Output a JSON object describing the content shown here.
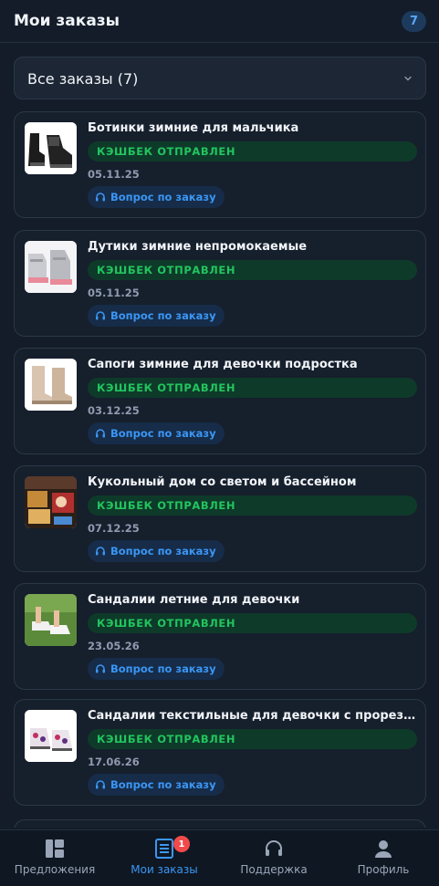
{
  "header": {
    "title": "Мои заказы",
    "count": "7"
  },
  "filter": {
    "label": "Все заказы (7)"
  },
  "orders": [
    {
      "name": "Ботинки зимние для мальчика",
      "status": "КЭШБЕК ОТПРАВЛЕН",
      "date": "05.11.25",
      "ask": "Вопрос по заказу"
    },
    {
      "name": "Дутики зимние непромокаемые",
      "status": "КЭШБЕК ОТПРАВЛЕН",
      "date": "05.11.25",
      "ask": "Вопрос по заказу"
    },
    {
      "name": "Сапоги зимние для девочки подростка",
      "status": "КЭШБЕК ОТПРАВЛЕН",
      "date": "03.12.25",
      "ask": "Вопрос по заказу"
    },
    {
      "name": "Кукольный дом со светом и бассейном",
      "status": "КЭШБЕК ОТПРАВЛЕН",
      "date": "07.12.25",
      "ask": "Вопрос по заказу"
    },
    {
      "name": "Сандалии летние для девочки",
      "status": "КЭШБЕК ОТПРАВЛЕН",
      "date": "23.05.26",
      "ask": "Вопрос по заказу"
    },
    {
      "name": "Сандалии текстильные для девочки с прорезиненн...",
      "status": "КЭШБЕК ОТПРАВЛЕН",
      "date": "17.06.26",
      "ask": "Вопрос по заказу"
    }
  ],
  "nav": {
    "offers": "Предложения",
    "orders": "Мои заказы",
    "orders_badge": "1",
    "support": "Поддержка",
    "profile": "Профиль"
  },
  "colors": {
    "background": "#131c28",
    "accent": "#3b96f5",
    "cashback": "#22c55e",
    "badge": "#f04a4a"
  }
}
